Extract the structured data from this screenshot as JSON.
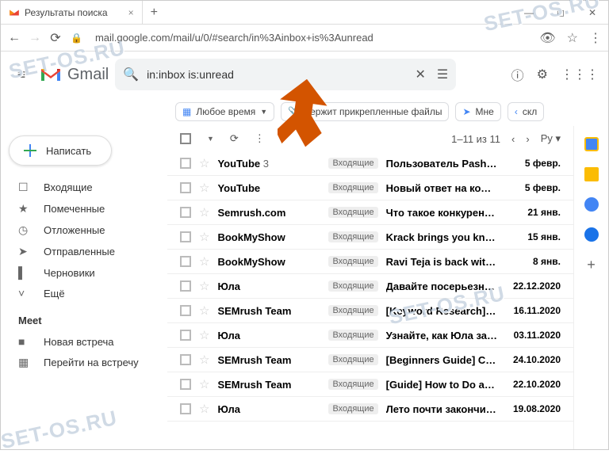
{
  "browser": {
    "tab_title": "Результаты поиска",
    "url": "mail.google.com/mail/u/0/#search/in%3Ainbox+is%3Aunread"
  },
  "header": {
    "brand": "Gmail",
    "search_value": "in:inbox is:unread"
  },
  "chips": {
    "time": "Любое время",
    "attach": "держит прикрепленные файлы",
    "to_me": "Мне",
    "excl": "скл"
  },
  "compose_label": "Написать",
  "nav": [
    {
      "icon": "☐",
      "label": "Входящие"
    },
    {
      "icon": "★",
      "label": "Помеченные"
    },
    {
      "icon": "◷",
      "label": "Отложенные"
    },
    {
      "icon": "➤",
      "label": "Отправленные"
    },
    {
      "icon": "▌",
      "label": "Черновики"
    },
    {
      "icon": "˅",
      "label": "Ещё"
    }
  ],
  "meet": {
    "title": "Meet",
    "new": "Новая встреча",
    "join": "Перейти на встречу"
  },
  "toolbar": {
    "range": "1–11 из 11",
    "lang": "Ру"
  },
  "inbox_label": "Входящие",
  "emails": [
    {
      "sender": "YouTube",
      "count": "3",
      "subject": "Пользователь Pashka ...",
      "date": "5 февр."
    },
    {
      "sender": "YouTube",
      "count": "",
      "subject": "Новый ответ на комм...",
      "date": "5 февр."
    },
    {
      "sender": "Semrush.com",
      "count": "",
      "subject": "Что такое конкурентн...",
      "date": "21 янв."
    },
    {
      "sender": "BookMyShow",
      "count": "",
      "subject": "Krack brings you knuckl...",
      "date": "15 янв."
    },
    {
      "sender": "BookMyShow",
      "count": "",
      "subject": "Ravi Teja is back with K...",
      "date": "8 янв."
    },
    {
      "sender": "Юла",
      "count": "",
      "subject": "Давайте посерьезнее -",
      "date": "22.12.2020"
    },
    {
      "sender": "SEMrush Team",
      "count": "",
      "subject": "[Keyword Research] W...",
      "date": "16.11.2020"
    },
    {
      "sender": "Юла",
      "count": "",
      "subject": "Узнайте, как Юла заб...",
      "date": "03.11.2020"
    },
    {
      "sender": "SEMrush Team",
      "count": "",
      "subject": "[Beginners Guide] Co...",
      "date": "24.10.2020"
    },
    {
      "sender": "SEMrush Team",
      "count": "",
      "subject": "[Guide] How to Do a C...",
      "date": "22.10.2020"
    },
    {
      "sender": "Юла",
      "count": "",
      "subject": "Лето почти закончил...",
      "date": "19.08.2020"
    }
  ],
  "watermark": "SET-OS.RU"
}
